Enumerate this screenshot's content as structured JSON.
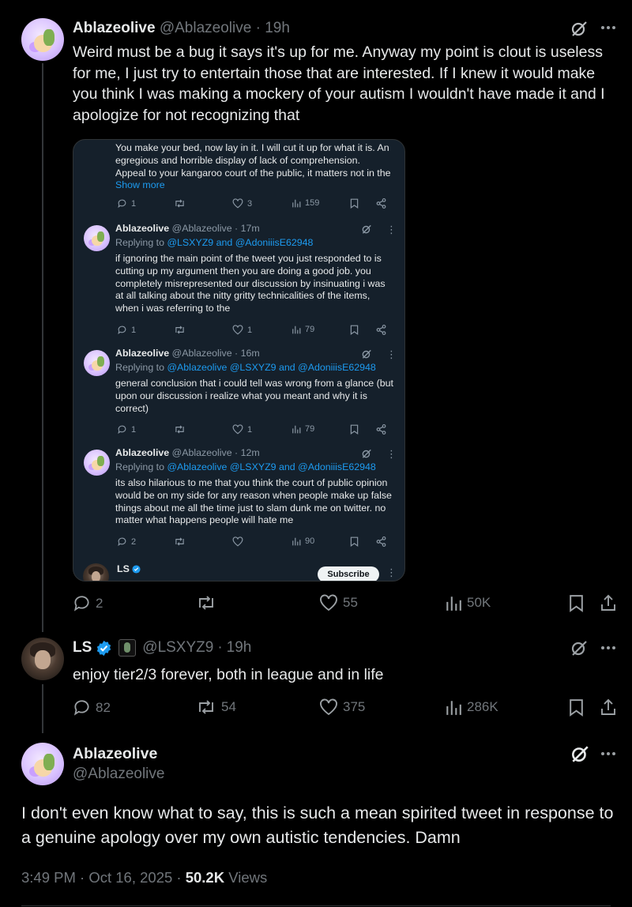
{
  "tweet1": {
    "display_name": "Ablazeolive",
    "handle": "@Ablazeolive",
    "time": "19h",
    "text": "Weird must be a bug it says it's up for me. Anyway my point is clout is useless for me, I just try to entertain those that are interested. If I knew it would make you think I was making a mockery of your autism I wouldn't have made it and I apologize for not recognizing that",
    "replies": "2",
    "reposts": "",
    "likes": "55",
    "views": "50K"
  },
  "embedded": {
    "top_text": "You make your bed, now lay in it. I will cut it up for what it is. An egregious and horrible display of lack of comprehension. Appeal to your kangaroo court of the public, it matters not in the",
    "show_more": "Show more",
    "top_stats": {
      "replies": "1",
      "reposts": "",
      "likes": "3",
      "views": "159"
    },
    "replies": [
      {
        "display_name": "Ablazeolive",
        "meta": "@Ablazeolive · 17m",
        "replying_prefix": "Replying to",
        "replying_to": "@LSXYZ9 and @AdoniiisE62948",
        "text": "if ignoring the main point of the tweet you just responded to is cutting up my argument then you are doing a good job. you completely misrepresented our discussion by insinuating i was at all talking about the nitty gritty technicalities of the items, when i was referring to the",
        "stats": {
          "replies": "1",
          "reposts": "",
          "likes": "1",
          "views": "79"
        }
      },
      {
        "display_name": "Ablazeolive",
        "meta": "@Ablazeolive · 16m",
        "replying_prefix": "Replying to",
        "replying_to": "@Ablazeolive @LSXYZ9 and @AdoniiisE62948",
        "text": "general conclusion that i could tell was wrong from a glance (but upon our discussion i realize what you meant and why it is correct)",
        "stats": {
          "replies": "1",
          "reposts": "",
          "likes": "1",
          "views": "79"
        }
      },
      {
        "display_name": "Ablazeolive",
        "meta": "@Ablazeolive · 12m",
        "replying_prefix": "Replying to",
        "replying_to": "@Ablazeolive @LSXYZ9 and @AdoniiisE62948",
        "text": "its also hilarious to me that you think the court of public opinion would be on my side for any reason when people make up false things about me all the time just to slam dunk me on twitter. no matter what happens people will hate me",
        "stats": {
          "replies": "2",
          "reposts": "",
          "likes": "",
          "views": "90"
        }
      }
    ],
    "bottom_name": "LS",
    "subscribe_label": "Subscribe"
  },
  "tweet2": {
    "display_name": "LS",
    "handle": "@LSXYZ9",
    "time": "19h",
    "text": "enjoy tier2/3 forever, both in league and in life",
    "replies": "82",
    "reposts": "54",
    "likes": "375",
    "views": "286K"
  },
  "main_tweet": {
    "display_name": "Ablazeolive",
    "handle": "@Ablazeolive",
    "text": "I don't even know what to say, this is such a mean spirited tweet in response to a genuine apology over my own autistic tendencies. Damn",
    "time": "3:49 PM · Oct 16, 2025 · ",
    "views_count": "50.2K",
    "views_label": "Views"
  },
  "colors": {
    "background": "#000000",
    "text": "#e7e9ea",
    "secondary": "#71767b",
    "link": "#1d9bf0",
    "verified": "#1d9bf0",
    "embedded_bg": "#15202b"
  },
  "icons": [
    "grok-icon",
    "more-icon",
    "reply-icon",
    "repost-icon",
    "like-icon",
    "views-icon",
    "bookmark-icon",
    "share-icon",
    "verified-badge-icon"
  ]
}
